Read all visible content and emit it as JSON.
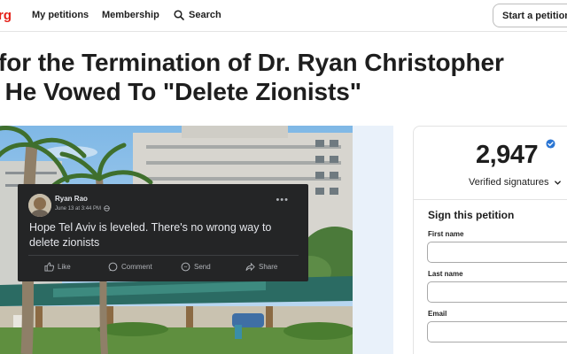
{
  "header": {
    "logo_text": "rg",
    "nav": {
      "my_petitions": "My petitions",
      "membership": "Membership",
      "search": "Search"
    },
    "start_petition": "Start a petition",
    "brand_color": "#e5231b"
  },
  "petition": {
    "title_line1": "for the Termination of Dr. Ryan Christopher",
    "title_line2": " He Vowed To \"Delete Zionists\""
  },
  "post": {
    "author": "Ryan Rao",
    "date": "June 13 at 3:44 PM",
    "text": "Hope Tel Aviv is leveled. There's no wrong way to delete zionists",
    "actions": {
      "like": "Like",
      "comment": "Comment",
      "send": "Send",
      "share": "Share"
    }
  },
  "signatures": {
    "count": "2,947",
    "label": "Verified signatures",
    "badge_color": "#2a75d3"
  },
  "form": {
    "heading": "Sign this petition",
    "first_name_label": "First name",
    "last_name_label": "Last name",
    "email_label": "Email"
  }
}
